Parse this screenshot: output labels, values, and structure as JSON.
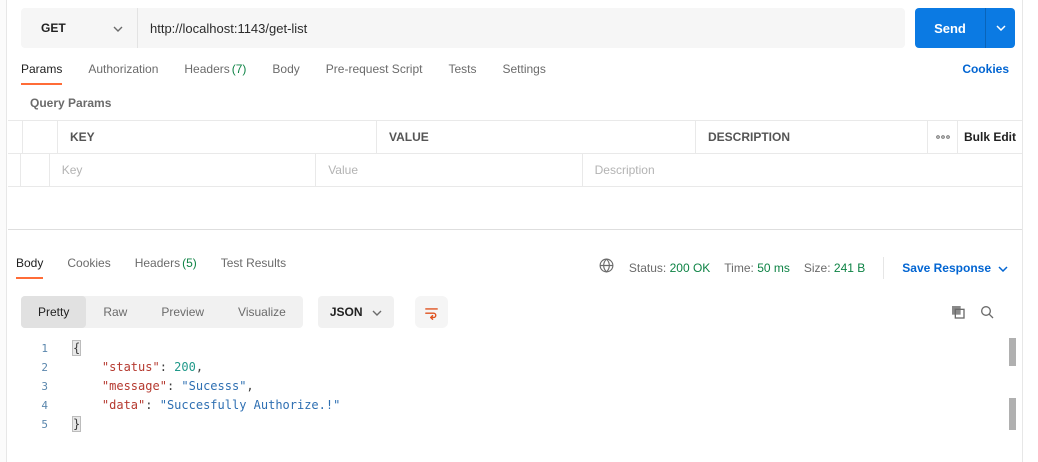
{
  "request": {
    "method": "GET",
    "url": "http://localhost:1143/get-list",
    "send_label": "Send",
    "tabs": [
      {
        "label": "Params"
      },
      {
        "label": "Authorization"
      },
      {
        "label": "Headers",
        "count": "(7)"
      },
      {
        "label": "Body"
      },
      {
        "label": "Pre-request Script"
      },
      {
        "label": "Tests"
      },
      {
        "label": "Settings"
      }
    ],
    "cookies_link": "Cookies",
    "query_params": {
      "title": "Query Params",
      "columns": {
        "key": "KEY",
        "value": "VALUE",
        "description": "DESCRIPTION"
      },
      "bulk_edit_label": "Bulk Edit",
      "placeholders": {
        "key": "Key",
        "value": "Value",
        "description": "Description"
      }
    }
  },
  "response": {
    "tabs": [
      {
        "label": "Body"
      },
      {
        "label": "Cookies"
      },
      {
        "label": "Headers",
        "count": "(5)"
      },
      {
        "label": "Test Results"
      }
    ],
    "meta": {
      "status_label": "Status:",
      "status_value": "200 OK",
      "time_label": "Time:",
      "time_value": "50 ms",
      "size_label": "Size:",
      "size_value": "241 B",
      "save_label": "Save Response"
    },
    "toolbar": {
      "modes": [
        "Pretty",
        "Raw",
        "Preview",
        "Visualize"
      ],
      "format": "JSON"
    },
    "body": {
      "lines": [
        [
          {
            "t": "brace",
            "v": "{"
          }
        ],
        [
          {
            "t": "punc",
            "v": "    "
          },
          {
            "t": "key",
            "v": "\"status\""
          },
          {
            "t": "punc",
            "v": ": "
          },
          {
            "t": "num",
            "v": "200"
          },
          {
            "t": "punc",
            "v": ","
          }
        ],
        [
          {
            "t": "punc",
            "v": "    "
          },
          {
            "t": "key",
            "v": "\"message\""
          },
          {
            "t": "punc",
            "v": ": "
          },
          {
            "t": "str",
            "v": "\"Sucesss\""
          },
          {
            "t": "punc",
            "v": ","
          }
        ],
        [
          {
            "t": "punc",
            "v": "    "
          },
          {
            "t": "key",
            "v": "\"data\""
          },
          {
            "t": "punc",
            "v": ": "
          },
          {
            "t": "str",
            "v": "\"Succesfully Authorize.!\""
          }
        ],
        [
          {
            "t": "brace",
            "v": "}"
          }
        ]
      ]
    }
  },
  "colors": {
    "accent_orange": "#ff6c37",
    "send_blue": "#0b7ae3",
    "link_blue": "#0265d2",
    "success_green": "#0e8345",
    "json_key": "#b5392f",
    "json_string": "#2e6fb2",
    "json_number": "#20998a"
  }
}
